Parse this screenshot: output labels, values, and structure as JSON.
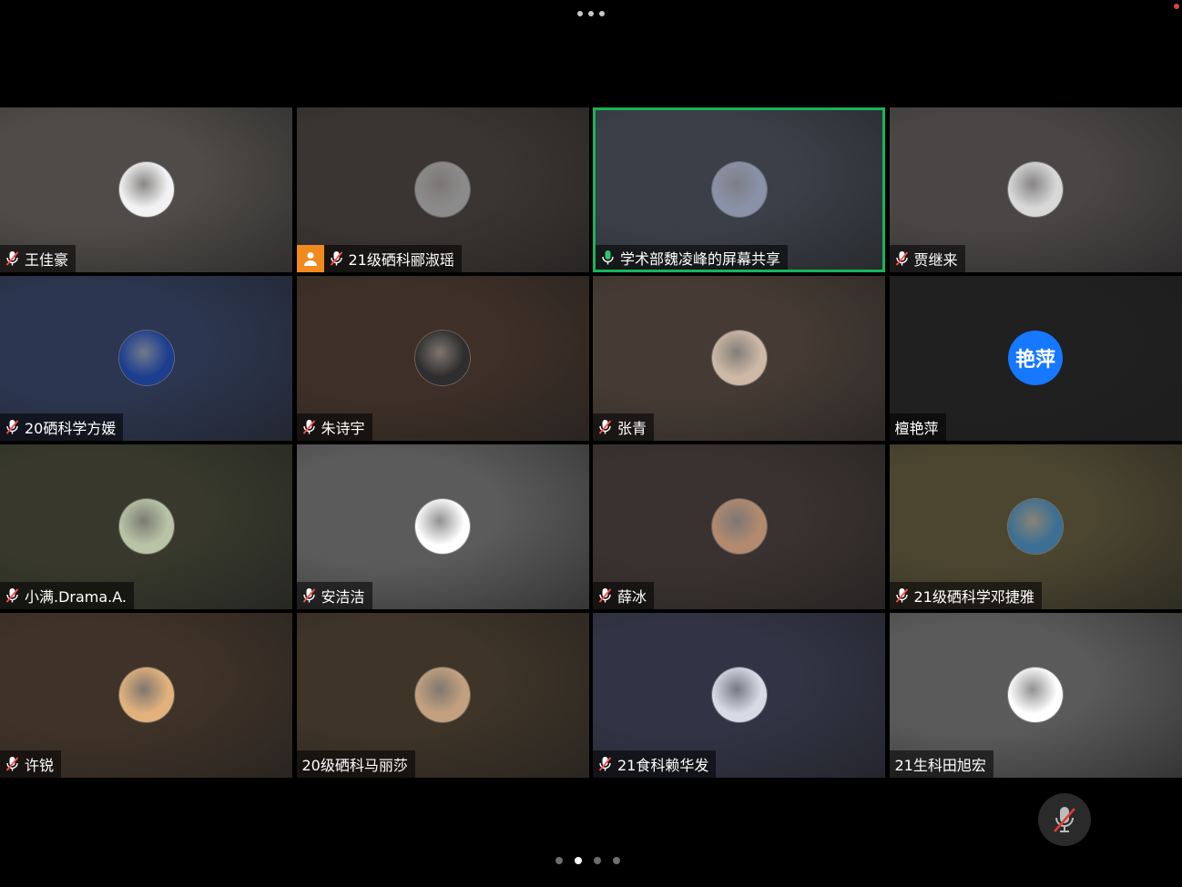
{
  "screen": {
    "more_icon": "ellipsis-icon",
    "recording_color": "#e0452f"
  },
  "tiles": [
    {
      "name": "王佳豪",
      "mic": "muted",
      "bg": "#4e4b48",
      "avatar": {
        "type": "image",
        "desc": "rocket",
        "bg": "#f2f2f4"
      }
    },
    {
      "name": "21级硒科郦淑瑶",
      "mic": "muted",
      "host": true,
      "bg": "#3a3532",
      "avatar": {
        "type": "image",
        "desc": "people-photo",
        "bg": "#8b8b8b"
      }
    },
    {
      "name": "学术部魏凌峰的屏幕共享",
      "mic": "on",
      "speaking": true,
      "bg": "#3b3f48",
      "avatar": {
        "type": "image",
        "desc": "person-sky",
        "bg": "#8a92a8"
      }
    },
    {
      "name": "贾继来",
      "mic": "muted",
      "bg": "#4a4646",
      "avatar": {
        "type": "image",
        "desc": "couple-umbrella",
        "bg": "#d8d8d8"
      }
    },
    {
      "name": "20硒科学方媛",
      "mic": "muted",
      "bg": "#2c3650",
      "avatar": {
        "type": "image",
        "desc": "nasa-logo",
        "bg": "#1d3e8f"
      }
    },
    {
      "name": "朱诗宇",
      "mic": "muted",
      "bg": "#3e3028",
      "avatar": {
        "type": "image",
        "desc": "smiling-girl",
        "bg": "#2e2e2e"
      }
    },
    {
      "name": "张青",
      "mic": "muted",
      "bg": "#463b34",
      "avatar": {
        "type": "image",
        "desc": "doll-face",
        "bg": "#cdb9a6"
      }
    },
    {
      "name": "檀艳萍",
      "mic": "none",
      "bg": "#202020",
      "avatar": {
        "type": "text",
        "text": "艳萍",
        "bg": "#1677ff"
      }
    },
    {
      "name": "小满.Drama.A.",
      "mic": "muted",
      "bg": "#38392c",
      "avatar": {
        "type": "image",
        "desc": "anime-girl",
        "bg": "#b9c4a7"
      }
    },
    {
      "name": "安洁洁",
      "mic": "muted",
      "bg": "#5b5b5b",
      "avatar": {
        "type": "image",
        "desc": "stick-figure",
        "bg": "#ffffff"
      }
    },
    {
      "name": "薛冰",
      "mic": "muted",
      "bg": "#3a3230",
      "avatar": {
        "type": "image",
        "desc": "girl-cat",
        "bg": "#b38a6e"
      }
    },
    {
      "name": "21级硒科学邓捷雅",
      "mic": "muted",
      "bg": "#4c4630",
      "avatar": {
        "type": "image",
        "desc": "frog",
        "bg": "#3c6f94"
      }
    },
    {
      "name": "许锐",
      "mic": "muted",
      "bg": "#3f3228",
      "avatar": {
        "type": "image",
        "desc": "cat",
        "bg": "#e3b27c"
      }
    },
    {
      "name": "20级硒科马丽莎",
      "mic": "none",
      "bg": "#3e3428",
      "avatar": {
        "type": "image",
        "desc": "bear",
        "bg": "#c4a17e"
      }
    },
    {
      "name": "21食科赖华发",
      "mic": "muted",
      "bg": "#323445",
      "avatar": {
        "type": "image",
        "desc": "cart-girl",
        "bg": "#d8dbe5"
      }
    },
    {
      "name": "21生科田旭宏",
      "mic": "none",
      "bg": "#5a5a5a",
      "avatar": {
        "type": "image",
        "desc": "doodle-face",
        "bg": "#ffffff"
      }
    }
  ],
  "pager": {
    "count": 4,
    "active_index": 1
  },
  "controls": {
    "mute_icon": "mic-off-icon"
  }
}
